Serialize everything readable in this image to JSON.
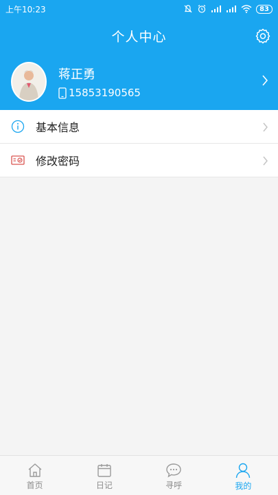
{
  "status_bar": {
    "time": "上午10:23",
    "battery": "83"
  },
  "header": {
    "title": "个人中心",
    "settings_icon": "gear-icon"
  },
  "profile": {
    "name": "蒋正勇",
    "phone": "15853190565"
  },
  "menu": [
    {
      "label": "基本信息",
      "icon": "info-icon"
    },
    {
      "label": "修改密码",
      "icon": "password-card-icon"
    }
  ],
  "tabs": [
    {
      "label": "首页",
      "icon": "home-icon",
      "active": false
    },
    {
      "label": "日记",
      "icon": "calendar-icon",
      "active": false
    },
    {
      "label": "寻呼",
      "icon": "chat-icon",
      "active": false
    },
    {
      "label": "我的",
      "icon": "person-icon",
      "active": true
    }
  ],
  "colors": {
    "primary": "#1aa6f0",
    "background": "#f4f4f4",
    "tab_inactive": "#8c8c8c"
  }
}
